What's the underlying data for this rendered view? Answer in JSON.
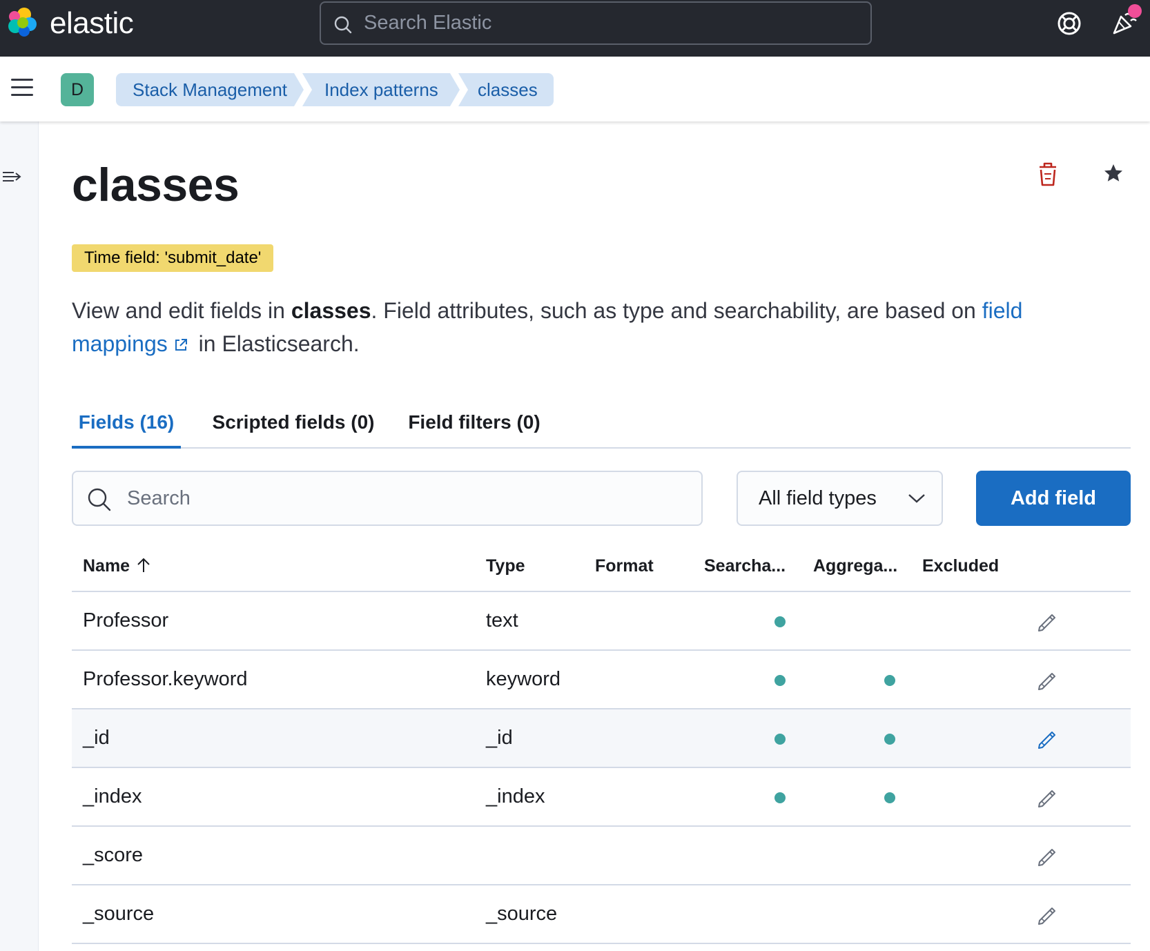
{
  "header": {
    "brand": "elastic",
    "search_placeholder": "Search Elastic",
    "colors": {
      "bg": "#25282f",
      "news_dot": "#f04e98"
    },
    "icons": [
      "elastic-logo-icon",
      "search-icon",
      "help-icon",
      "newsfeed-icon"
    ]
  },
  "nav": {
    "space_initial": "D",
    "breadcrumbs": [
      "Stack Management",
      "Index patterns",
      "classes"
    ]
  },
  "page": {
    "title": "classes",
    "time_field_badge": "Time field: 'submit_date'",
    "description": {
      "part1": "View and edit fields in ",
      "index_name": "classes",
      "part2": ". Field attributes, such as type and searchability, are based on ",
      "link": "field mappings",
      "part3": " in Elasticsearch."
    }
  },
  "tabs": [
    {
      "label": "Fields (16)",
      "selected": true
    },
    {
      "label": "Scripted fields (0)",
      "selected": false
    },
    {
      "label": "Field filters (0)",
      "selected": false
    }
  ],
  "toolbar": {
    "search_placeholder": "Search",
    "type_filter": "All field types",
    "add_button": "Add field"
  },
  "table": {
    "columns": [
      "Name",
      "Type",
      "Format",
      "Searcha...",
      "Aggrega...",
      "Excluded"
    ],
    "sort": {
      "column": "Name",
      "direction": "ascending"
    },
    "rows": [
      {
        "name": "Professor",
        "type": "text",
        "format": "",
        "searchable": true,
        "aggregatable": false,
        "excluded": false
      },
      {
        "name": "Professor.keyword",
        "type": "keyword",
        "format": "",
        "searchable": true,
        "aggregatable": true,
        "excluded": false
      },
      {
        "name": "_id",
        "type": "_id",
        "format": "",
        "searchable": true,
        "aggregatable": true,
        "excluded": false,
        "hovered": true
      },
      {
        "name": "_index",
        "type": "_index",
        "format": "",
        "searchable": true,
        "aggregatable": true,
        "excluded": false
      },
      {
        "name": "_score",
        "type": "",
        "format": "",
        "searchable": false,
        "aggregatable": false,
        "excluded": false
      },
      {
        "name": "_source",
        "type": "_source",
        "format": "",
        "searchable": false,
        "aggregatable": false,
        "excluded": false
      }
    ]
  },
  "colors": {
    "accent": "#1a6dc2",
    "badge": "#f1d86f",
    "status_dot": "#3fa3a0",
    "danger": "#bd271e"
  }
}
